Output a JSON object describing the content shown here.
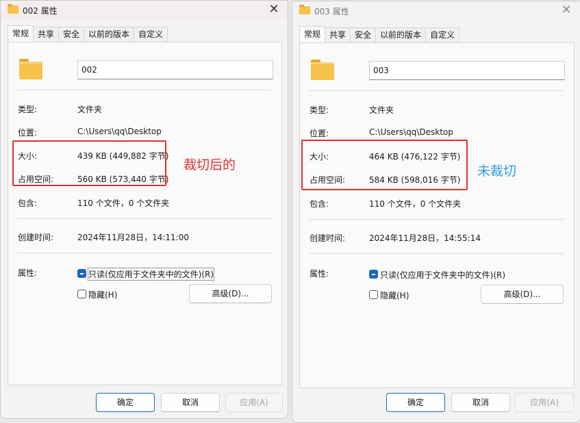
{
  "left": {
    "title": "002 属性",
    "tabs": [
      "常规",
      "共享",
      "安全",
      "以前的版本",
      "自定义"
    ],
    "name": "002",
    "type_label": "类型:",
    "type_value": "文件夹",
    "location_label": "位置:",
    "location_value": "C:\\Users\\qq\\Desktop",
    "size_label": "大小:",
    "size_value": "439 KB (449,882 字节)",
    "disk_label": "占用空间:",
    "disk_value": "560 KB (573,440 字节)",
    "contains_label": "包含:",
    "contains_value": "110 个文件，0 个文件夹",
    "created_label": "创建时间:",
    "created_value": "2024年11月28日，14:11:00",
    "attr_label": "属性:",
    "readonly_label": "只读(仅应用于文件夹中的文件)(R)",
    "hidden_label": "隐藏(H)",
    "advanced_label": "高级(D)...",
    "ok_label": "确定",
    "cancel_label": "取消",
    "apply_label": "应用(A)",
    "annotation": "裁切后的"
  },
  "right": {
    "title": "003 属性",
    "tabs": [
      "常规",
      "共享",
      "安全",
      "以前的版本",
      "自定义"
    ],
    "name": "003",
    "type_label": "类型:",
    "type_value": "文件夹",
    "location_label": "位置:",
    "location_value": "C:\\Users\\qq\\Desktop",
    "size_label": "大小:",
    "size_value": "464 KB (476,122 字节)",
    "disk_label": "占用空间:",
    "disk_value": "584 KB (598,016 字节)",
    "contains_label": "包含:",
    "contains_value": "110 个文件，0 个文件夹",
    "created_label": "创建时间:",
    "created_value": "2024年11月28日，14:55:14",
    "attr_label": "属性:",
    "readonly_label": "只读(仅应用于文件夹中的文件)(R)",
    "hidden_label": "隐藏(H)",
    "advanced_label": "高级(D)...",
    "ok_label": "确定",
    "cancel_label": "取消",
    "apply_label": "应用(A)",
    "annotation": "未裁切"
  },
  "colors": {
    "annotation_left": "#e0302d",
    "annotation_right": "#2f9be0",
    "highlight_box": "#e0302d",
    "accent": "#1a67c2"
  },
  "icons": {
    "folder": "folder-icon",
    "close": "close-icon"
  }
}
